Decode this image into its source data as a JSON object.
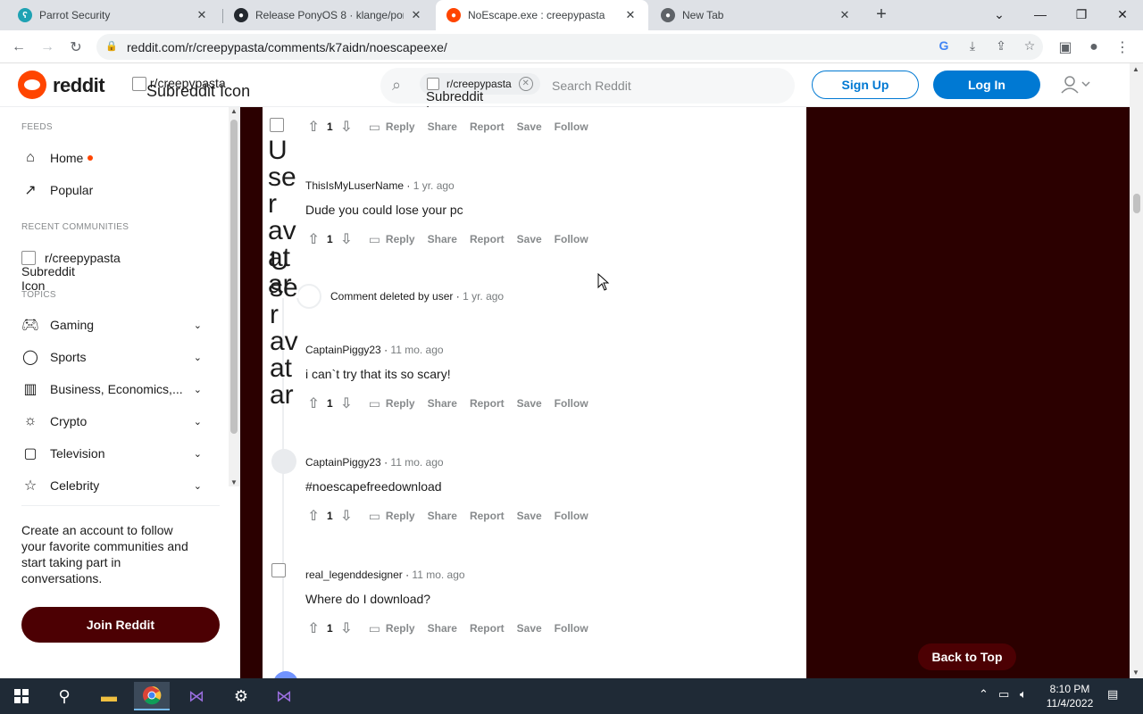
{
  "browser": {
    "tabs": [
      {
        "title": "Parrot Security",
        "color": "#1fa2b3"
      },
      {
        "title": "Release PonyOS 8 · klange/ponyc",
        "color": "#24292f"
      },
      {
        "title": "NoEscape.exe : creepypasta",
        "color": "#ff4500"
      },
      {
        "title": "New Tab",
        "color": "#5f6368"
      }
    ],
    "url": "reddit.com/r/creepypasta/comments/k7aidn/noescapeexe/"
  },
  "header": {
    "wordmark": "reddit",
    "subreddit": "r/creepypasta",
    "subreddit_alt": "Subreddit Icon",
    "search_chip": "r/creepypasta",
    "search_chip_alt": "Subreddit\nIcon",
    "search_placeholder": "Search Reddit",
    "signup": "Sign Up",
    "login": "Log In"
  },
  "sidebar": {
    "feeds_heading": "FEEDS",
    "home": "Home",
    "popular": "Popular",
    "recent_heading": "RECENT COMMUNITIES",
    "recent_community": "r/creepypasta",
    "recent_alt": "Subreddit\nIcon",
    "topics_heading": "TOPICS",
    "topics": [
      "Gaming",
      "Sports",
      "Business, Economics,...",
      "Crypto",
      "Television",
      "Celebrity"
    ],
    "cta": "Create an account to follow your favorite communities and start taking part in conversations.",
    "join": "Join Reddit"
  },
  "comments": [
    {
      "user": "",
      "time": "",
      "body": "",
      "score": "1"
    },
    {
      "user": "ThisIsMyLuserName",
      "time": "1 yr. ago",
      "body": "Dude you could lose your pc",
      "score": "1"
    },
    {
      "user": "",
      "time": "1 yr. ago",
      "body": "Comment deleted by user",
      "score": ""
    },
    {
      "user": "CaptainPiggy23",
      "time": "11 mo. ago",
      "body": "i can`t try that its so scary!",
      "score": "1"
    },
    {
      "user": "CaptainPiggy23",
      "time": "11 mo. ago",
      "body": "#noescapefreedownload",
      "score": "1"
    },
    {
      "user": "real_legenddesigner",
      "time": "11 mo. ago",
      "body": "Where do I download?",
      "score": "1"
    }
  ],
  "actions": {
    "reply": "Reply",
    "share": "Share",
    "report": "Report",
    "save": "Save",
    "follow": "Follow"
  },
  "broken_alt_1": "User avatar",
  "broken_alt_2": "User avatar",
  "back_to_top": "Back to Top",
  "taskbar": {
    "time": "8:10 PM",
    "date": "11/4/2022"
  }
}
